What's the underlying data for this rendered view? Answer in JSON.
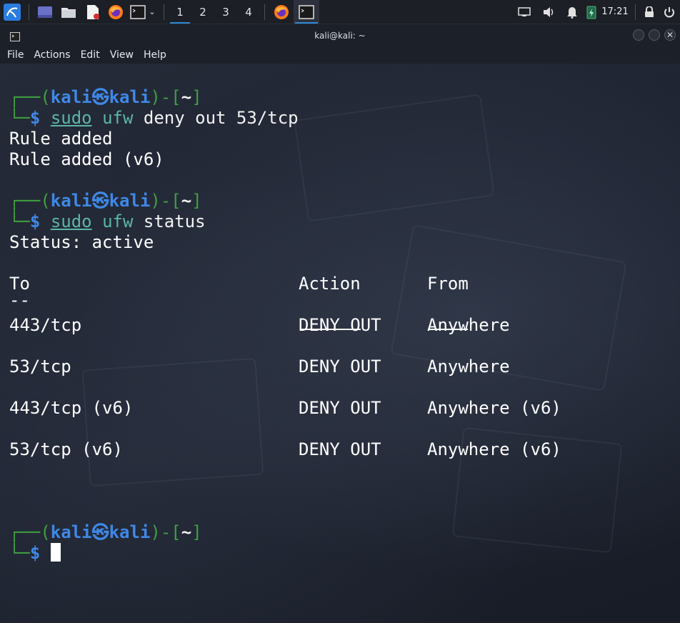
{
  "taskbar": {
    "launchers": [
      "kali-menu-icon",
      "desktop-icon",
      "file-manager-icon",
      "text-editor-icon",
      "firefox-icon",
      "terminal-icon"
    ],
    "workspaces": [
      "1",
      "2",
      "3",
      "4"
    ],
    "active_workspace": "1",
    "tasks": [
      "firefox-task",
      "terminal-task"
    ],
    "tray": [
      "screen-icon",
      "volume-icon",
      "notification-bell-icon",
      "battery-icon"
    ],
    "clock": "17:21",
    "lock": "lock-icon",
    "power": "power-icon"
  },
  "window": {
    "title": "kali@kali: ~",
    "menu": [
      "File",
      "Actions",
      "Edit",
      "View",
      "Help"
    ]
  },
  "terminal": {
    "prompt": {
      "top_prefix": "┌──(",
      "user": "kali",
      "sep": "㉿",
      "host": "kali",
      "mid": ")-[",
      "dir": "~",
      "end": "]",
      "bottom_prefix": "└─",
      "dollar": "$"
    },
    "cmd1": {
      "sudo": "sudo",
      "ufw": "ufw",
      "args": " deny out 53/tcp"
    },
    "out1": [
      "Rule added",
      "Rule added (v6)"
    ],
    "cmd2": {
      "sudo": "sudo",
      "ufw": "ufw",
      "args": " status"
    },
    "status": "Status: active",
    "table": {
      "headers": [
        "To",
        "Action",
        "From"
      ],
      "to_dash": "--",
      "rows": [
        [
          "443/tcp",
          "DENY OUT",
          "Anywhere"
        ],
        [
          "53/tcp",
          "DENY OUT",
          "Anywhere"
        ],
        [
          "443/tcp (v6)",
          "DENY OUT",
          "Anywhere (v6)"
        ],
        [
          "53/tcp (v6)",
          "DENY OUT",
          "Anywhere (v6)"
        ]
      ]
    }
  },
  "colors": {
    "prompt_frame": "#3fa03f",
    "prompt_user": "#3f88e6",
    "command": "#5ab6a8",
    "text": "#ffffff"
  }
}
